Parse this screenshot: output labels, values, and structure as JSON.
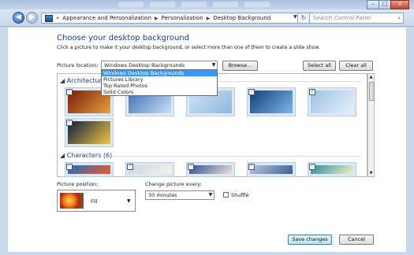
{
  "window": {
    "controls": {
      "minimize": "–",
      "maximize": "□",
      "close": "X"
    }
  },
  "nav": {
    "back": "◀",
    "forward": "▶",
    "breadcrumb": [
      {
        "label": "«"
      },
      {
        "label": "Appearance and Personalization"
      },
      {
        "label": "Personalization"
      },
      {
        "label": "Desktop Background"
      }
    ],
    "search_placeholder": "Search Control Panel",
    "refresh": "↻"
  },
  "page": {
    "title": "Choose your desktop background",
    "subtitle": "Click a picture to make it your desktop background, or select more than one of them to create a slide show."
  },
  "location": {
    "label": "Picture location:",
    "selected": "Windows Desktop Backgrounds",
    "options": [
      "Windows Desktop Backgrounds",
      "Pictures Library",
      "Top Rated Photos",
      "Solid Colors"
    ],
    "browse": "Browse...",
    "select_all": "Select all",
    "clear_all": "Clear all"
  },
  "groups": [
    {
      "name": "Architecture",
      "count_text": "",
      "thumbs": [
        {
          "colors": [
            "#7a1a0c",
            "#e6a23a"
          ]
        },
        {
          "colors": [
            "#3d6fb6",
            "#c7dff5"
          ]
        },
        {
          "colors": [
            "#cfe2f5",
            "#8fb6df"
          ]
        },
        {
          "colors": [
            "#123f7a",
            "#79b6e8"
          ]
        },
        {
          "colors": [
            "#9bc0e3",
            "#e7f1fb"
          ]
        },
        {
          "colors": [
            "#0b1d3f",
            "#f2c640"
          ]
        }
      ]
    },
    {
      "name": "Characters",
      "count_text": "(6)",
      "thumbs": [
        {
          "colors": [
            "#1f6fc2",
            "#e85d2a"
          ]
        },
        {
          "colors": [
            "#cdd6dc",
            "#f5f2e8"
          ]
        },
        {
          "colors": [
            "#2d4f8f",
            "#f0e0d0"
          ]
        },
        {
          "colors": [
            "#b9c9e0",
            "#3f5f8f"
          ]
        },
        {
          "colors": [
            "#2a8a9a",
            "#f5f0c8"
          ]
        }
      ]
    }
  ],
  "position": {
    "label": "Picture position:",
    "value": "Fill"
  },
  "interval": {
    "label": "Change picture every:",
    "value": "30 minutes",
    "shuffle_label": "Shuffle",
    "shuffle": false
  },
  "footer": {
    "save": "Save changes",
    "cancel": "Cancel"
  },
  "colors": {
    "accent": "#1e3f8a",
    "selection": "#3399ff"
  }
}
